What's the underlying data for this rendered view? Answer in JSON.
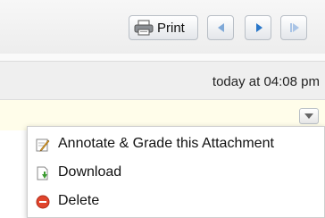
{
  "toolbar": {
    "print_label": "Print",
    "icons": {
      "print": "printer-icon",
      "previous": "triangle-left-icon",
      "next": "triangle-right-icon",
      "last": "skip-to-end-icon"
    }
  },
  "attachment": {
    "timestamp": "today at 04:08 pm"
  },
  "menu": {
    "items": [
      {
        "label": "Annotate & Grade this Attachment",
        "icon": "pencil-note-icon"
      },
      {
        "label": "Download",
        "icon": "download-icon"
      },
      {
        "label": "Delete",
        "icon": "delete-icon"
      }
    ]
  },
  "colors": {
    "nav_accent": "#2a77c9",
    "attachment_bg": "#fffdea",
    "delete_red": "#e0442c",
    "download_green": "#3a9b2f"
  }
}
